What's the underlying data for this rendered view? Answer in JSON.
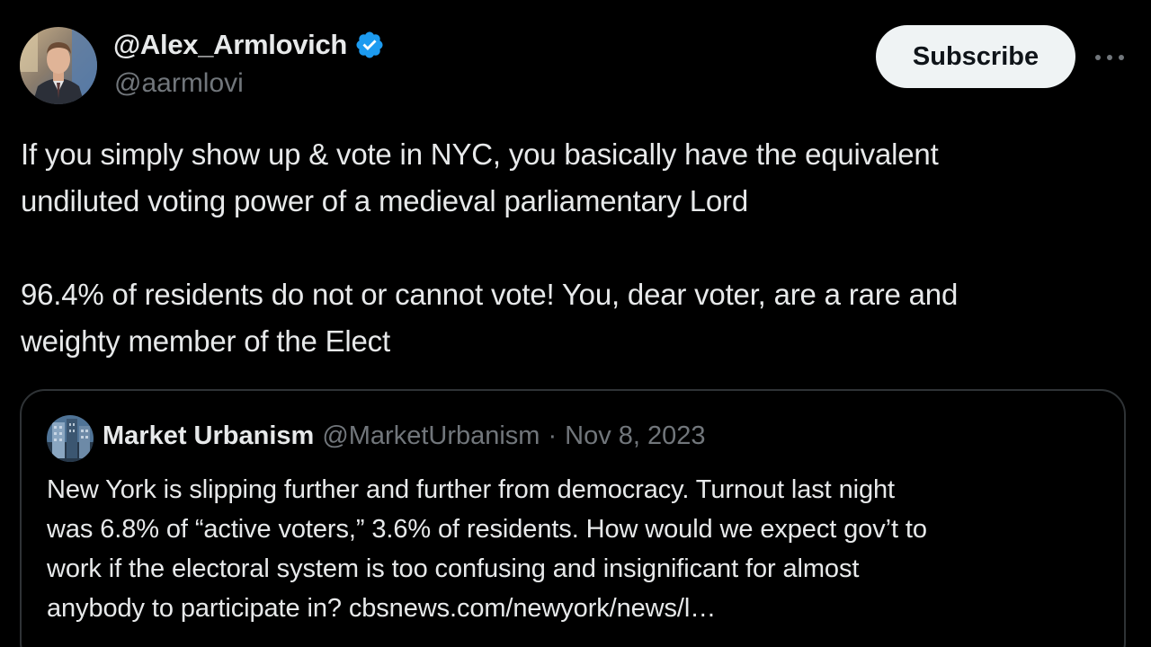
{
  "tweet": {
    "author": {
      "display_name": "@Alex_Armlovich",
      "handle": "@aarmlovi",
      "verified": true
    },
    "subscribe_label": "Subscribe",
    "more_label": "···",
    "text_lines": [
      "If you simply show up & vote in NYC, you basically have the equivalent",
      "undiluted voting power of a medieval parliamentary Lord",
      "96.4% of residents do not or cannot vote! You, dear voter, are a rare and",
      "weighty member of the Elect"
    ]
  },
  "quoted_tweet": {
    "display_name": "Market Urbanism",
    "handle": "@MarketUrbanism",
    "separator": "·",
    "date": "Nov 8, 2023",
    "text_lines": [
      "New York is slipping further and further from democracy. Turnout last night",
      "was 6.8% of “active voters,” 3.6% of residents. How would we expect gov’t to",
      "work if the electoral system is too confusing and insignificant for almost",
      "anybody to participate in? cbsnews.com/newyork/news/l…"
    ]
  },
  "colors": {
    "background": "#000000",
    "primary_text": "#e7e9ea",
    "secondary_text": "#71767b",
    "verified_blue": "#1d9bf0",
    "border": "#2f3336",
    "button_bg": "#eff3f4"
  },
  "icons": {
    "verified": "verified-badge-icon",
    "more": "more-horizontal-icon"
  }
}
